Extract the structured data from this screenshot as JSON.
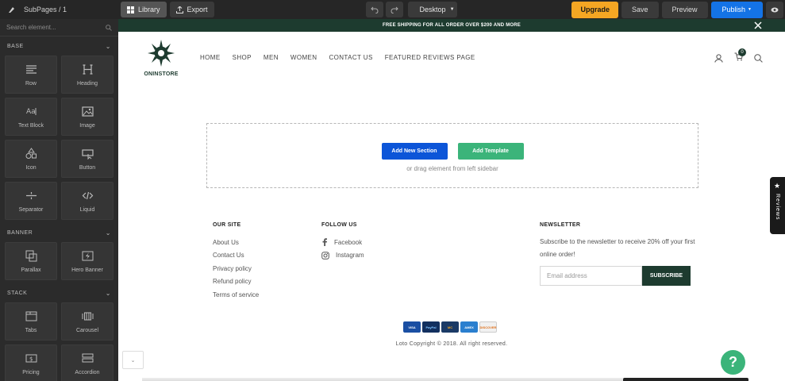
{
  "toolbar": {
    "breadcrumb": "SubPages / 1",
    "library_label": "Library",
    "export_label": "Export",
    "device_label": "Desktop",
    "upgrade_label": "Upgrade",
    "save_label": "Save",
    "preview_label": "Preview",
    "publish_label": "Publish"
  },
  "sidebar": {
    "search_placeholder": "Search element...",
    "sections": [
      {
        "title": "BASE",
        "items": [
          "Row",
          "Heading",
          "Text Block",
          "Image",
          "Icon",
          "Button",
          "Separator",
          "Liquid"
        ]
      },
      {
        "title": "BANNER",
        "items": [
          "Parallax",
          "Hero Banner"
        ]
      },
      {
        "title": "STACK",
        "items": [
          "Tabs",
          "Carousel",
          "Pricing",
          "Accordion"
        ]
      }
    ]
  },
  "store": {
    "promo": "FREE SHIPPING FOR ALL ORDER OVER $200 AND MORE",
    "brand": "ONINSTORE",
    "menu": [
      "HOME",
      "SHOP",
      "MEN",
      "WOMEN",
      "CONTACT US",
      "FEATURED REVIEWS PAGE"
    ],
    "cart_count": "0"
  },
  "dropzone": {
    "add_section": "Add New Section",
    "add_template": "Add Template",
    "hint": "or drag element from left sidebar"
  },
  "reviews_tab": "Reviews",
  "footer": {
    "our_site": {
      "title": "OUR SITE",
      "links": [
        "About Us",
        "Contact Us",
        "Privacy policy",
        "Refund policy",
        "Terms of service"
      ]
    },
    "follow_us": {
      "title": "FOLLOW US",
      "links": [
        "Facebook",
        "Instagram"
      ]
    },
    "newsletter": {
      "title": "NEWSLETTER",
      "text": "Subscribe to the newsletter to receive 20% off your first online order!",
      "placeholder": "Email address",
      "button": "SUBSCRIBE"
    },
    "payments": [
      "VISA",
      "PayPal",
      "MC",
      "AMEX",
      "DISCOVER"
    ],
    "copyright": "Loto Copyright © 2018. All right reserved."
  },
  "help_label": "?",
  "colors": {
    "brand_green": "#1d3b2f",
    "accent_blue": "#0c55d8",
    "accent_green": "#3bb47a",
    "upgrade": "#f5a623"
  }
}
